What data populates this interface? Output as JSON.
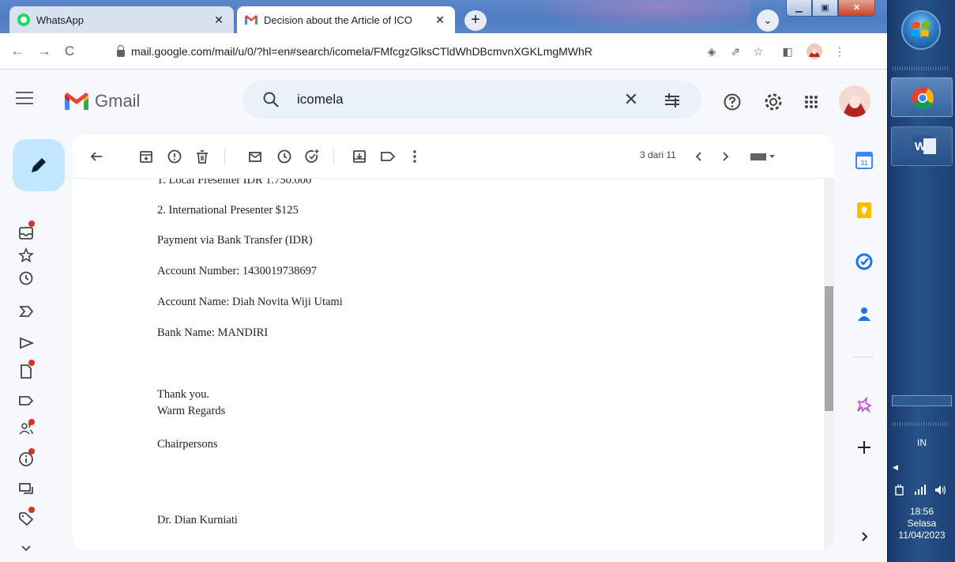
{
  "browser": {
    "tabs": [
      {
        "title": "WhatsApp",
        "active": false
      },
      {
        "title": "Decision about the Article of ICO",
        "active": true
      }
    ],
    "url": "mail.google.com/mail/u/0/?hl=en#search/icomela/FMfcgzGlksCTldWhDBcmvnXGKLmgMWhR"
  },
  "gmail": {
    "logo_text": "Gmail",
    "search_value": "icomela",
    "pager_text": "3 dari 11"
  },
  "message": {
    "lines": [
      "1. Local Presenter IDR 1.750.000",
      "2. International Presenter $125",
      "Payment via Bank Transfer (IDR)",
      "Account Number: 1430019738697",
      "Account Name: Diah Novita Wiji Utami",
      "Bank Name: MANDIRI",
      "Thank you.",
      "Warm Regards",
      "Chairpersons",
      "Dr. Dian Kurniati"
    ]
  },
  "taskbar": {
    "language": "IN",
    "time": "18:56",
    "day": "Selasa",
    "date": "11/04/2023"
  },
  "colors": {
    "gmail_red": "#ea4335",
    "compose_bg": "#c2e7ff",
    "search_bg": "#eaf1fb",
    "notification_dot": "#d93025"
  }
}
